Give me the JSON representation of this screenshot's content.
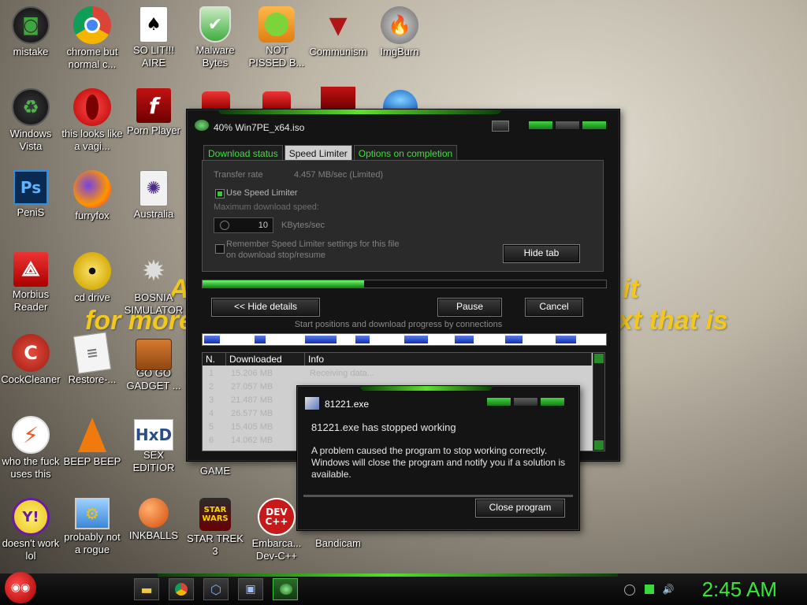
{
  "desktop": {
    "wallpaper_text": [
      "A",
      "for more",
      "it",
      "xt that is"
    ],
    "icons": [
      {
        "label": "mistake",
        "icon": "nvidia-icon"
      },
      {
        "label": "chrome but normal c...",
        "icon": "chrome-icon"
      },
      {
        "label": "SO LIT!!! AIRE",
        "icon": "cards-icon"
      },
      {
        "label": "Malware Bytes",
        "icon": "shield-icon"
      },
      {
        "label": "NOT PISSED B...",
        "icon": "angry-birds-pig-icon"
      },
      {
        "label": "Communism",
        "icon": "communism-logo-icon"
      },
      {
        "label": "ImgBurn",
        "icon": "disc-fire-icon"
      },
      {
        "label": "Windows Vista",
        "icon": "recycle-icon"
      },
      {
        "label": "this looks like a vagi...",
        "icon": "opera-icon"
      },
      {
        "label": "Porn Player",
        "icon": "flash-icon"
      },
      {
        "label": "PeniS",
        "icon": "photoshop-icon"
      },
      {
        "label": "furryfox",
        "icon": "firefox-icon"
      },
      {
        "label": "Australia",
        "icon": "spider-solitaire-icon"
      },
      {
        "label": "Morbius Reader",
        "icon": "acrobat-icon"
      },
      {
        "label": "cd drive",
        "icon": "cd-icon"
      },
      {
        "label": "BOSNIA SIMULATOR",
        "icon": "mine-icon"
      },
      {
        "label": "CockCleaner",
        "icon": "ccleaner-icon"
      },
      {
        "label": "Restore-...",
        "icon": "document-icon"
      },
      {
        "label": "GO GO GADGET ...",
        "icon": "briefcase-icon"
      },
      {
        "label": "who the fuck uses this",
        "icon": "lightning-icon"
      },
      {
        "label": "BEEP BEEP",
        "icon": "vlc-cone-icon"
      },
      {
        "label": "SEX EDITIOR",
        "icon": "hxd-icon"
      },
      {
        "label": "GAME",
        "icon": "game-icon"
      },
      {
        "label": "doesn't work lol",
        "icon": "yahoo-messenger-icon"
      },
      {
        "label": "probably not a rogue",
        "icon": "gears-monitor-icon"
      },
      {
        "label": "INKBALLS",
        "icon": "inkball-icon"
      },
      {
        "label": "STAR TREK 3",
        "icon": "star-wars-icon"
      },
      {
        "label": "Embarca... Dev-C++",
        "icon": "devcpp-icon"
      },
      {
        "label": "Bandicam",
        "icon": "bandicam-icon"
      }
    ]
  },
  "download_window": {
    "title": "40% Win7PE_x64.iso",
    "tabs": [
      "Download status",
      "Speed Limiter",
      "Options on completion"
    ],
    "active_tab": "Speed Limiter",
    "transfer_rate_label": "Transfer rate",
    "transfer_rate_value": "4.457  MB/sec  (Limited)",
    "use_speed_limiter_label": "Use Speed Limiter",
    "use_speed_limiter_checked": true,
    "max_speed_label": "Maximum download speed:",
    "max_speed_value": "10",
    "max_speed_unit": "KBytes/sec",
    "remember_label_1": "Remember Speed Limiter settings for this file",
    "remember_label_2": "on download stop/resume",
    "hide_tab_label": "Hide tab",
    "progress_percent": 40,
    "hide_details_label": "<< Hide details",
    "pause_label": "Pause",
    "cancel_label": "Cancel",
    "connections_caption": "Start positions and download progress by connections",
    "table_headers": [
      "N.",
      "Downloaded",
      "Info"
    ],
    "rows": [
      {
        "n": "1",
        "downloaded": "15.206 MB",
        "info": "Receiving data..."
      },
      {
        "n": "2",
        "downloaded": "27.057 MB",
        "info": ""
      },
      {
        "n": "3",
        "downloaded": "21.487 MB",
        "info": ""
      },
      {
        "n": "4",
        "downloaded": "26.577 MB",
        "info": ""
      },
      {
        "n": "5",
        "downloaded": "15.405 MB",
        "info": ""
      },
      {
        "n": "6",
        "downloaded": "14.062 MB",
        "info": ""
      }
    ]
  },
  "error_dialog": {
    "title": "81221.exe",
    "heading": "81221.exe has stopped working",
    "message": "A problem caused the program to stop working correctly. Windows will close the program and notify you if a solution is available.",
    "close_button": "Close program"
  },
  "taskbar": {
    "clock": "2:45 AM",
    "accent": "#37e637"
  }
}
